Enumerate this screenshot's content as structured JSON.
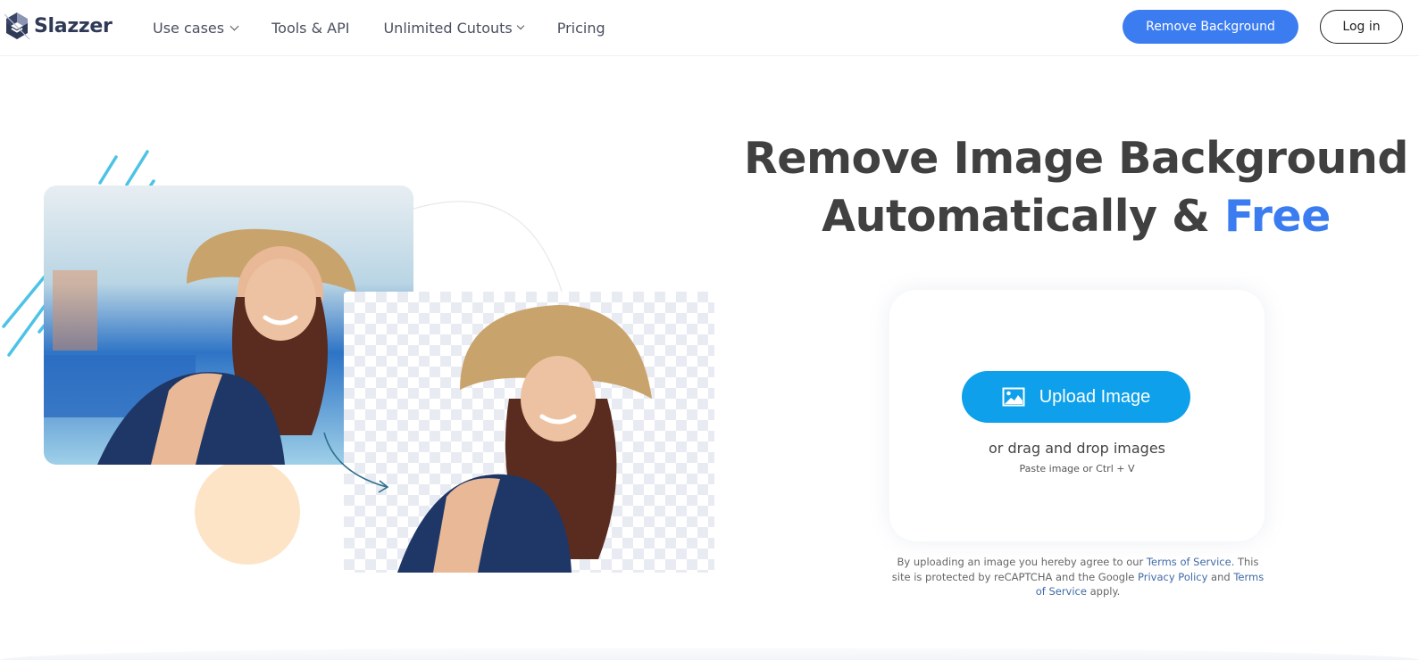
{
  "header": {
    "brand": "Slazzer",
    "nav": [
      {
        "label": "Use cases",
        "has_dropdown": true
      },
      {
        "label": "Tools & API",
        "has_dropdown": false
      },
      {
        "label": "Unlimited Cutouts",
        "has_dropdown": true
      },
      {
        "label": "Pricing",
        "has_dropdown": false
      }
    ],
    "remove_bg_label": "Remove Background",
    "login_label": "Log in"
  },
  "hero": {
    "title_line1": "Remove Image Background",
    "title_line2_prefix": "Automatically & ",
    "title_line2_accent": "Free"
  },
  "upload": {
    "button_label": "Upload Image",
    "button_icon": "image-icon",
    "drag_text": "or drag and drop images",
    "paste_text": "Paste image or Ctrl + V"
  },
  "legal": {
    "part1": "By uploading an image you hereby agree to our ",
    "link1": "Terms of Service",
    "part2": ". This site is protected by reCAPTCHA and the Google ",
    "link2": "Privacy Policy",
    "part3": " and ",
    "link3": "Terms of Service",
    "part4": " apply."
  },
  "illustration": {
    "before_alt": "Woman in straw hat with harbor background",
    "after_alt": "Woman in straw hat with background removed"
  },
  "colors": {
    "accent": "#3b7df0",
    "upload_button": "#0ea0ea",
    "heading": "#404040",
    "peach": "#fde4c6",
    "decor_lines": "#4cc3e6"
  }
}
